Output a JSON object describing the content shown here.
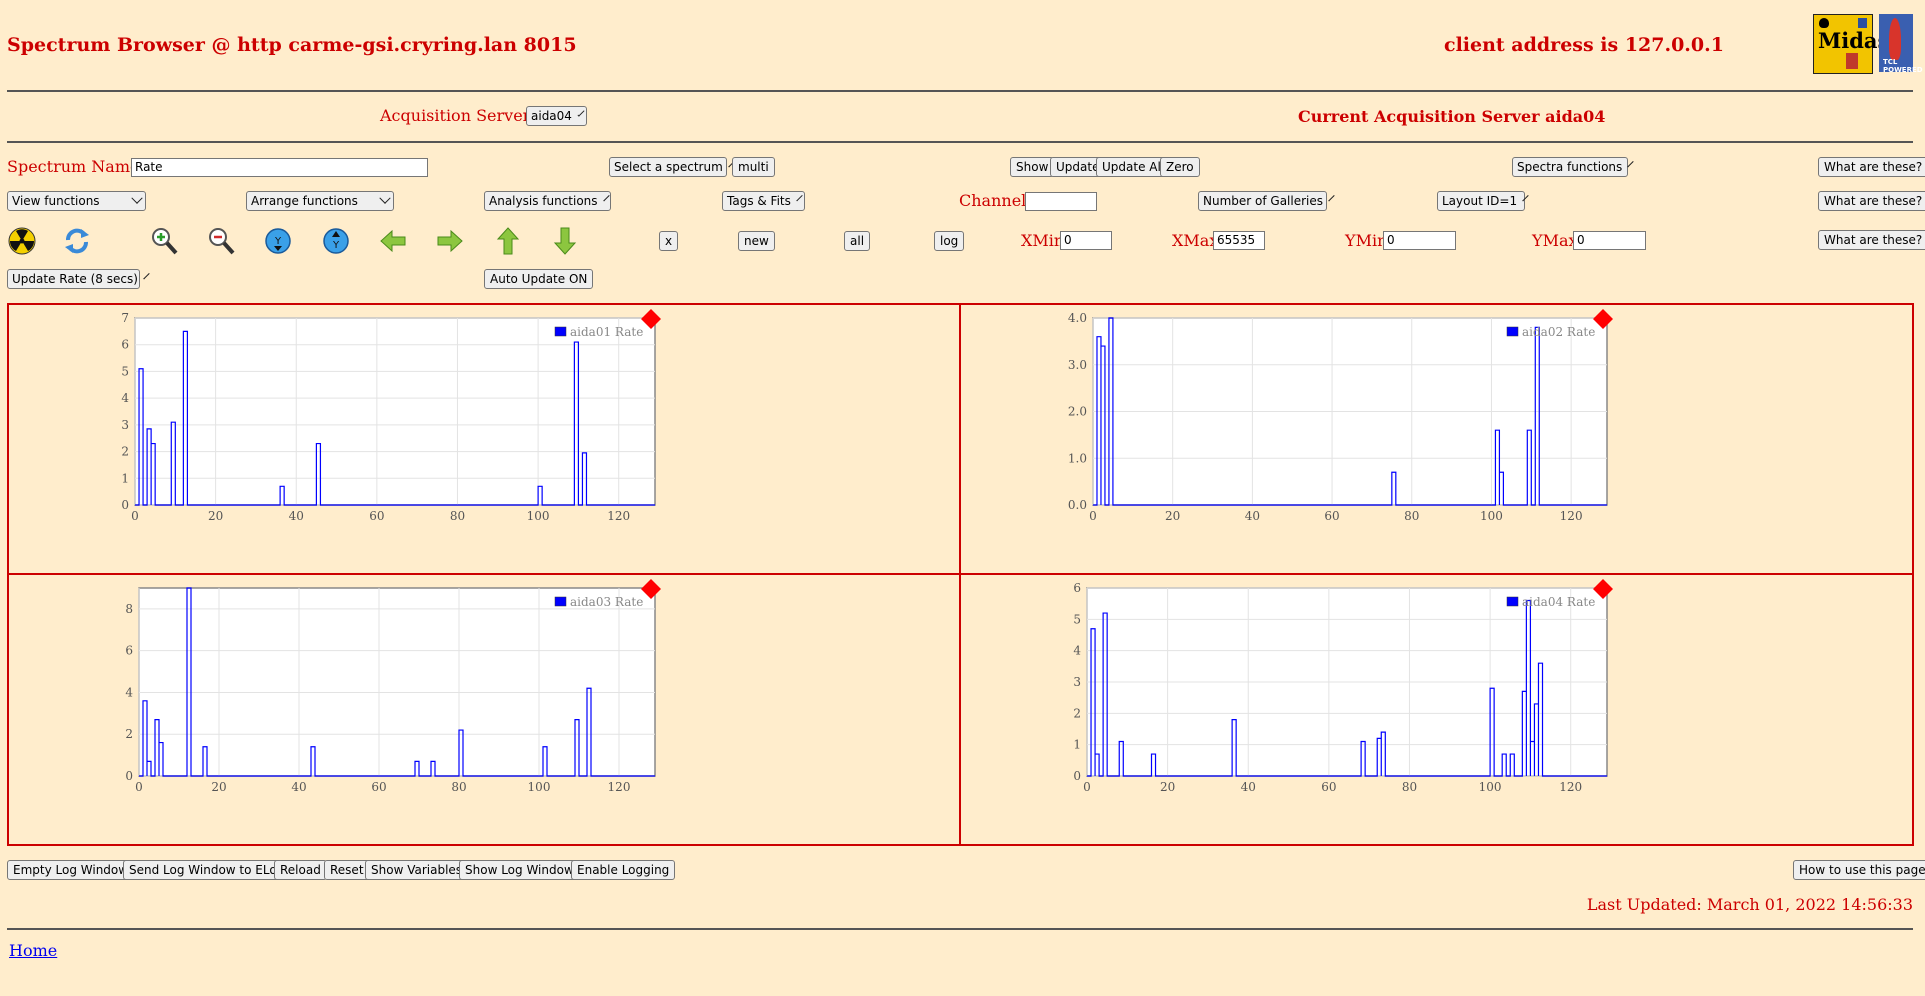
{
  "header": {
    "title": "Spectrum Browser @ http carme-gsi.cryring.lan 8015",
    "client_address": "client address is 127.0.0.1",
    "logo_text": "Midas",
    "logo_tcl": "TCL POWERED"
  },
  "acquisition": {
    "label": "Acquisition Servers",
    "server_select": "aida04",
    "current_label": "Current Acquisition Server aida04"
  },
  "row1": {
    "spectrum_name_label": "Spectrum Name:",
    "spectrum_name_value": "Rate",
    "select_spectrum": "Select a spectrum",
    "multi": "multi",
    "show": "Show",
    "update": "Update",
    "update_all": "Update All",
    "zero": "Zero",
    "spectra_functions": "Spectra functions",
    "what": "What are these?"
  },
  "row2": {
    "view_functions": "View functions",
    "arrange_functions": "Arrange functions",
    "analysis_functions": "Analysis functions",
    "tags_fits": "Tags & Fits",
    "channel_label": "Channel:",
    "channel_value": "",
    "galleries": "Number of Galleries",
    "layout": "Layout ID=1",
    "what": "What are these?"
  },
  "row3": {
    "x": "x",
    "new": "new",
    "all": "all",
    "log": "log",
    "xmin_label": "XMin",
    "xmin_value": "0",
    "xmax_label": "XMax",
    "xmax_value": "65535",
    "ymin_label": "YMin",
    "ymin_value": "0",
    "ymax_label": "YMax",
    "ymax_value": "0",
    "what": "What are these?",
    "icons": [
      "radiation-icon",
      "refresh-icon",
      "zoom-in-icon",
      "zoom-out-icon",
      "y-down-icon",
      "y-up-icon",
      "arrow-left-icon",
      "arrow-right-icon",
      "arrow-up-icon",
      "arrow-down-icon"
    ]
  },
  "row4": {
    "update_rate": "Update Rate (8 secs)",
    "auto_update": "Auto Update ON"
  },
  "colors": {
    "series": "#0000ff",
    "marker": "#ff0000",
    "frame": "#cc0000"
  },
  "chart_data": [
    {
      "type": "line",
      "legend": "aida01 Rate",
      "xlim": [
        0,
        129
      ],
      "ylim": [
        0,
        7
      ],
      "x_ticks": [
        0,
        20,
        40,
        60,
        80,
        100,
        120
      ],
      "y_ticks": [
        0,
        1,
        2,
        3,
        4,
        5,
        6,
        7
      ],
      "y_tick_labels": [
        "0",
        "1",
        "2",
        "3",
        "4",
        "5",
        "6",
        "7"
      ],
      "peaks": [
        [
          1,
          5.1
        ],
        [
          3,
          2.85
        ],
        [
          4,
          2.3
        ],
        [
          9,
          3.1
        ],
        [
          12,
          6.5
        ],
        [
          36,
          0.7
        ],
        [
          45,
          2.3
        ],
        [
          100,
          0.7
        ],
        [
          109,
          6.1
        ],
        [
          111,
          1.95
        ]
      ]
    },
    {
      "type": "line",
      "legend": "aida02 Rate",
      "xlim": [
        0,
        129
      ],
      "ylim": [
        0,
        4
      ],
      "x_ticks": [
        0,
        20,
        40,
        60,
        80,
        100,
        120
      ],
      "y_ticks": [
        0,
        1,
        2,
        3,
        4
      ],
      "y_tick_labels": [
        "0.0",
        "1.0",
        "2.0",
        "3.0",
        "4.0"
      ],
      "peaks": [
        [
          1,
          3.6
        ],
        [
          2,
          3.4
        ],
        [
          4,
          4.5
        ],
        [
          75,
          0.7
        ],
        [
          101,
          1.6
        ],
        [
          102,
          0.7
        ],
        [
          109,
          1.6
        ],
        [
          111,
          3.8
        ]
      ]
    },
    {
      "type": "line",
      "legend": "aida03 Rate",
      "xlim": [
        0,
        129
      ],
      "ylim": [
        0,
        9
      ],
      "x_ticks": [
        0,
        20,
        40,
        60,
        80,
        100,
        120
      ],
      "y_ticks": [
        0,
        2,
        4,
        6,
        8
      ],
      "y_tick_labels": [
        "0",
        "2",
        "4",
        "6",
        "8"
      ],
      "peaks": [
        [
          1,
          3.6
        ],
        [
          2,
          0.7
        ],
        [
          4,
          2.7
        ],
        [
          5,
          1.6
        ],
        [
          12,
          9.5
        ],
        [
          16,
          1.4
        ],
        [
          43,
          1.4
        ],
        [
          69,
          0.7
        ],
        [
          73,
          0.7
        ],
        [
          80,
          2.2
        ],
        [
          101,
          1.4
        ],
        [
          109,
          2.7
        ],
        [
          112,
          4.2
        ]
      ]
    },
    {
      "type": "line",
      "legend": "aida04 Rate",
      "xlim": [
        0,
        129
      ],
      "ylim": [
        0,
        6
      ],
      "x_ticks": [
        0,
        20,
        40,
        60,
        80,
        100,
        120
      ],
      "y_ticks": [
        0,
        1,
        2,
        3,
        4,
        5,
        6
      ],
      "y_tick_labels": [
        "0",
        "1",
        "2",
        "3",
        "4",
        "5",
        "6"
      ],
      "peaks": [
        [
          1,
          4.7
        ],
        [
          2,
          0.7
        ],
        [
          4,
          5.2
        ],
        [
          8,
          1.1
        ],
        [
          16,
          0.7
        ],
        [
          36,
          1.8
        ],
        [
          68,
          1.1
        ],
        [
          72,
          1.2
        ],
        [
          73,
          1.4
        ],
        [
          100,
          2.8
        ],
        [
          103,
          0.7
        ],
        [
          105,
          0.7
        ],
        [
          108,
          2.7
        ],
        [
          109,
          5.6
        ],
        [
          110,
          1.1
        ],
        [
          111,
          2.3
        ],
        [
          112,
          3.6
        ]
      ]
    }
  ],
  "footer": {
    "buttons": [
      "Empty Log Window",
      "Send Log Window to ELog",
      "Reload",
      "Reset",
      "Show Variables",
      "Show Log Window",
      "Enable Logging"
    ],
    "how_to": "How to use this page",
    "last_updated": "Last Updated: March 01, 2022 14:56:33",
    "home": "Home"
  }
}
